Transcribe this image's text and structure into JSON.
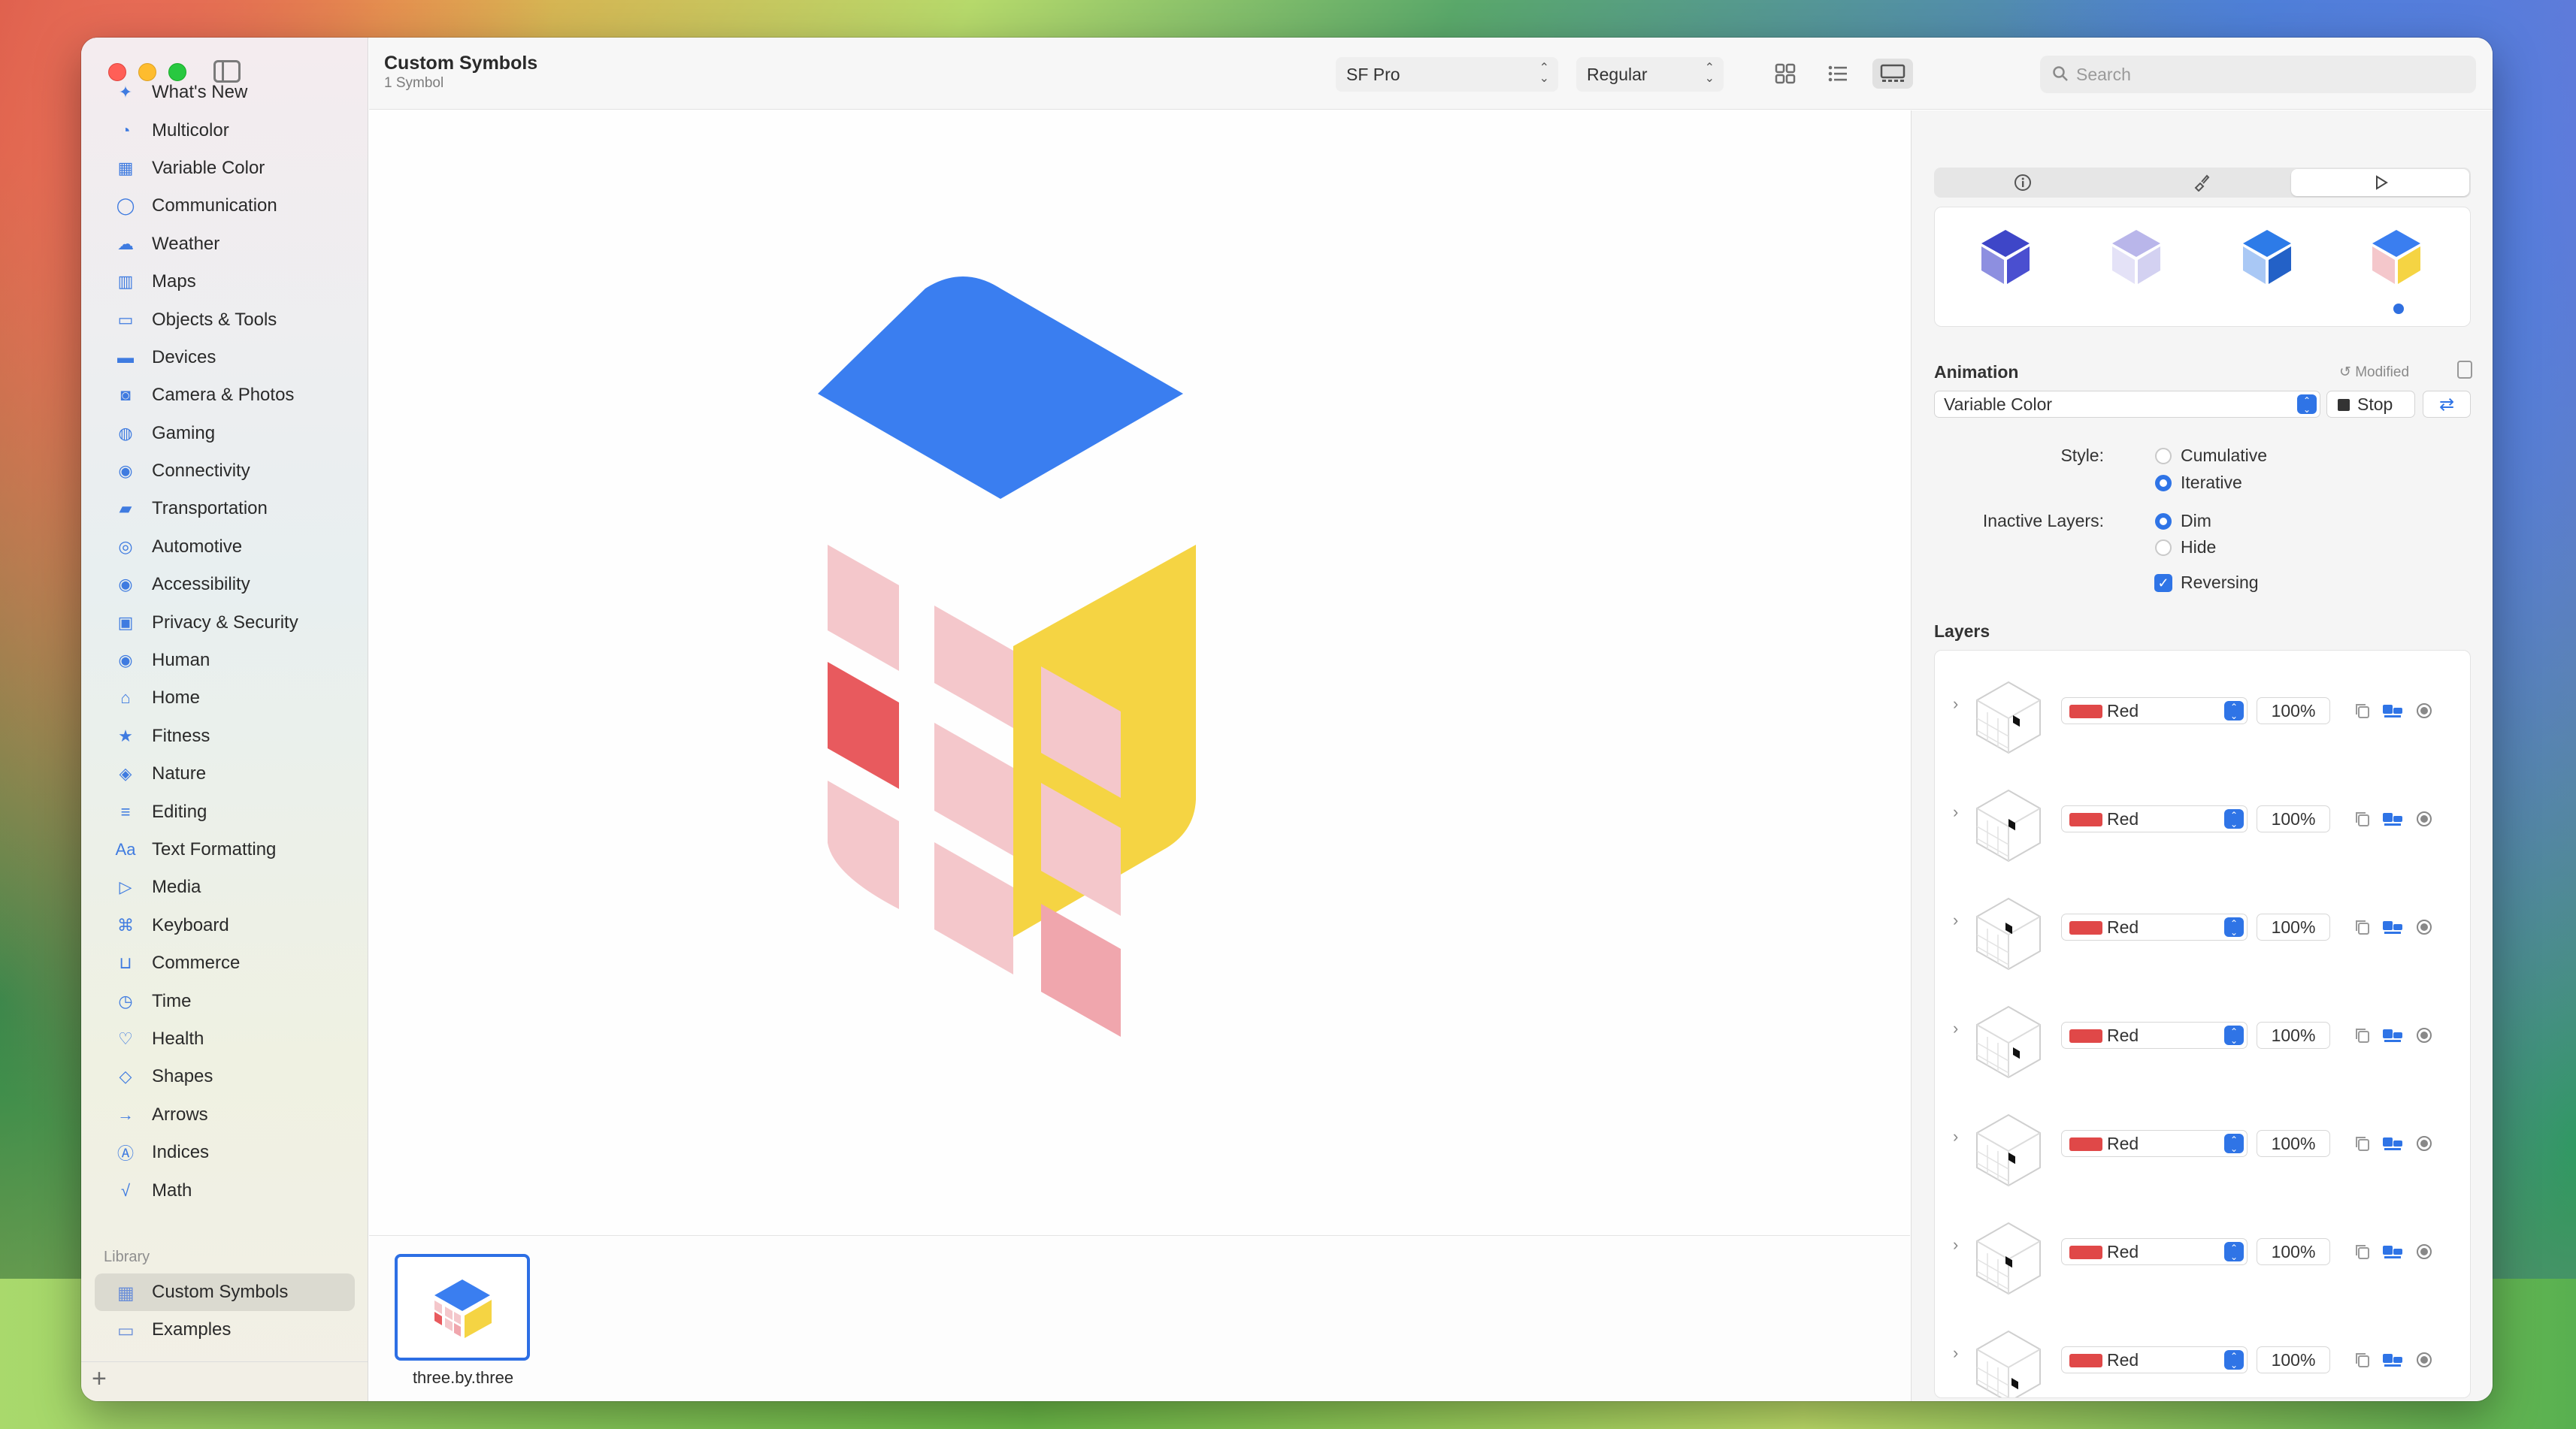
{
  "window": {
    "title": "Custom Symbols",
    "subtitle": "1 Symbol"
  },
  "toolbar": {
    "font_select": "SF Pro",
    "weight_select": "Regular",
    "search_placeholder": "Search",
    "icons": [
      "grid-view-icon",
      "list-view-icon",
      "gallery-view-icon",
      "inspector-toggle-icon"
    ]
  },
  "sidebar": {
    "items": [
      {
        "label": "What's New",
        "icon": "sparkle-icon"
      },
      {
        "label": "Multicolor",
        "icon": "palette-icon"
      },
      {
        "label": "Variable Color",
        "icon": "variable-color-icon"
      },
      {
        "label": "Communication",
        "icon": "message-icon"
      },
      {
        "label": "Weather",
        "icon": "cloud-sun-icon"
      },
      {
        "label": "Maps",
        "icon": "map-icon"
      },
      {
        "label": "Objects & Tools",
        "icon": "folder-icon"
      },
      {
        "label": "Devices",
        "icon": "desktop-icon"
      },
      {
        "label": "Camera & Photos",
        "icon": "camera-icon"
      },
      {
        "label": "Gaming",
        "icon": "gamecontroller-icon"
      },
      {
        "label": "Connectivity",
        "icon": "antenna-icon"
      },
      {
        "label": "Transportation",
        "icon": "car-icon"
      },
      {
        "label": "Automotive",
        "icon": "steering-wheel-icon"
      },
      {
        "label": "Accessibility",
        "icon": "accessibility-icon"
      },
      {
        "label": "Privacy & Security",
        "icon": "lock-icon"
      },
      {
        "label": "Human",
        "icon": "person-icon"
      },
      {
        "label": "Home",
        "icon": "house-icon"
      },
      {
        "label": "Fitness",
        "icon": "figure-run-icon"
      },
      {
        "label": "Nature",
        "icon": "leaf-icon"
      },
      {
        "label": "Editing",
        "icon": "sliders-icon"
      },
      {
        "label": "Text Formatting",
        "icon": "textformat-icon"
      },
      {
        "label": "Media",
        "icon": "playpause-icon"
      },
      {
        "label": "Keyboard",
        "icon": "command-icon"
      },
      {
        "label": "Commerce",
        "icon": "cart-icon"
      },
      {
        "label": "Time",
        "icon": "clock-icon"
      },
      {
        "label": "Health",
        "icon": "heart-icon"
      },
      {
        "label": "Shapes",
        "icon": "shapes-icon"
      },
      {
        "label": "Arrows",
        "icon": "arrow-right-icon"
      },
      {
        "label": "Indices",
        "icon": "a-circle-icon"
      },
      {
        "label": "Math",
        "icon": "sqrt-icon"
      }
    ],
    "library_label": "Library",
    "library_items": [
      {
        "label": "Custom Symbols",
        "active": true,
        "icon": "grid-icon"
      },
      {
        "label": "Examples",
        "active": false,
        "icon": "folder-icon"
      }
    ],
    "add_label": "+"
  },
  "canvas": {
    "symbol_name": "three.by.three",
    "colors": {
      "blue": "#3a7ef0",
      "yellow": "#f5d443",
      "pink": "#f4c7cb",
      "red_dim": "#f0a6ad",
      "red": "#e85a5e"
    }
  },
  "inspector": {
    "tabs": [
      "info-icon",
      "paintbrush-icon",
      "play-icon"
    ],
    "active_tab": 2,
    "animation_title": "Animation",
    "modified_label": "Modified",
    "animation_value": "Variable Color",
    "stop_label": "Stop",
    "style_label": "Style:",
    "style_options": [
      {
        "label": "Cumulative",
        "selected": false
      },
      {
        "label": "Iterative",
        "selected": true
      }
    ],
    "inactive_label": "Inactive Layers:",
    "inactive_options": [
      {
        "label": "Dim",
        "selected": true
      },
      {
        "label": "Hide",
        "selected": false
      }
    ],
    "reversing_label": "Reversing",
    "reversing_checked": true,
    "layers_title": "Layers",
    "layers": [
      {
        "color": "Red",
        "opacity": "100%"
      },
      {
        "color": "Red",
        "opacity": "100%"
      },
      {
        "color": "Red",
        "opacity": "100%"
      },
      {
        "color": "Red",
        "opacity": "100%"
      },
      {
        "color": "Red",
        "opacity": "100%"
      },
      {
        "color": "Red",
        "opacity": "100%"
      },
      {
        "color": "Red",
        "opacity": "100%"
      }
    ],
    "bottom_add": "+",
    "bottom_more": "⋯"
  }
}
